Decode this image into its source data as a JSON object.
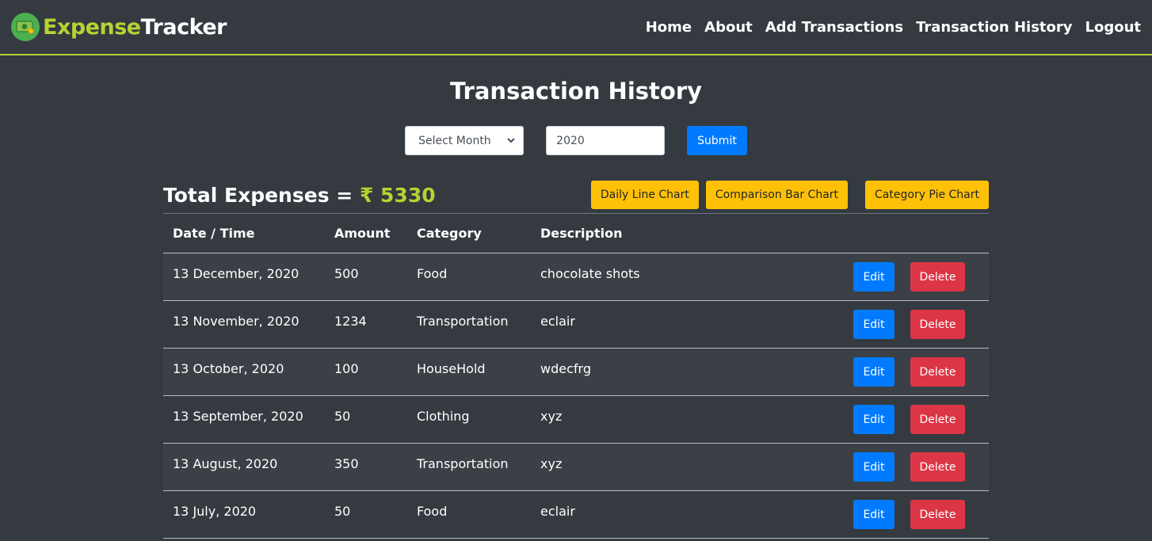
{
  "navbar": {
    "brand_part1": "Expense",
    "brand_part2": "Tracker",
    "logo_icon": "money-icon",
    "links": [
      "Home",
      "About",
      "Add Transactions",
      "Transaction History",
      "Logout"
    ]
  },
  "page_title": "Transaction History",
  "filter": {
    "month_selected": "Select Month",
    "year_value": "2020",
    "submit_label": "Submit"
  },
  "summary": {
    "total_label": "Total Expenses = ",
    "total_amount": "₹ 5330",
    "chart_buttons": [
      "Daily Line Chart",
      "Comparison Bar Chart",
      "Category Pie Chart"
    ]
  },
  "table": {
    "headers": [
      "Date / Time",
      "Amount",
      "Category",
      "Description"
    ],
    "rows": [
      {
        "date": "13 December, 2020",
        "amount": "500",
        "category": "Food",
        "description": "chocolate shots"
      },
      {
        "date": "13 November, 2020",
        "amount": "1234",
        "category": "Transportation",
        "description": "eclair"
      },
      {
        "date": "13 October, 2020",
        "amount": "100",
        "category": "HouseHold",
        "description": "wdecfrg"
      },
      {
        "date": "13 September, 2020",
        "amount": "50",
        "category": "Clothing",
        "description": "xyz"
      },
      {
        "date": "13 August, 2020",
        "amount": "350",
        "category": "Transportation",
        "description": "xyz"
      },
      {
        "date": "13 July, 2020",
        "amount": "50",
        "category": "Food",
        "description": "eclair"
      }
    ],
    "edit_label": "Edit",
    "delete_label": "Delete"
  },
  "colors": {
    "background": "#343a40",
    "accent": "#b5d334",
    "primary": "#007bff",
    "warning": "#ffc107",
    "danger": "#dc3545"
  }
}
